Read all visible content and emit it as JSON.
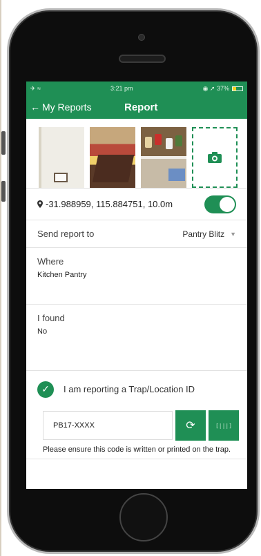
{
  "status_bar": {
    "left_icons": "✈ ≈",
    "time": "3:21 pm",
    "right_icons": "◉ ➚ 37%",
    "battery_level": 0.37
  },
  "nav": {
    "back_label": "My Reports",
    "back_icon": "chevron-left-icon",
    "title": "Report"
  },
  "photos": {
    "count": 3,
    "add_icon": "camera-icon"
  },
  "location": {
    "icon": "map-pin-icon",
    "text": "-31.988959, 115.884751, 10.0m",
    "toggle_on": true
  },
  "send_to": {
    "label": "Send report to",
    "value": "Pantry Blitz"
  },
  "where": {
    "label": "Where",
    "value": "Kitchen Pantry"
  },
  "found": {
    "label": "I found",
    "value": "No"
  },
  "trap": {
    "checked": true,
    "label": "I am reporting a Trap/Location ID",
    "code_value": "PB17-XXXX",
    "refresh_icon": "refresh-icon",
    "scan_icon": "barcode-scan-icon",
    "note": "Please ensure this code is written or printed on the trap."
  },
  "colors": {
    "accent": "#1f8f55"
  }
}
